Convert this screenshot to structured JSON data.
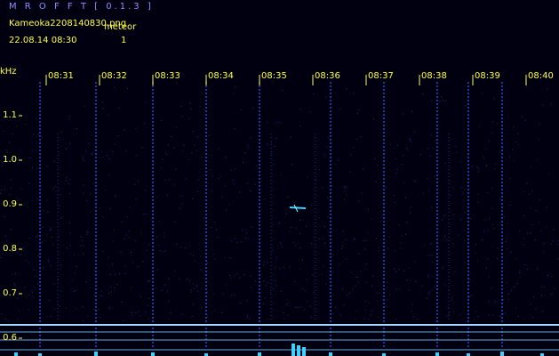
{
  "header": {
    "app_title": "M R O F F T [ 0.1.3 ]",
    "file_name": "Kameoka2208140830.png",
    "timestamp": "22.08.14 08:30",
    "meteor_label": "meteor",
    "meteor_count": "1"
  },
  "y_axis": {
    "unit": "kHz",
    "ticks": [
      "1.1",
      "1.0",
      "0.9",
      "0.8",
      "0.7",
      "0.6"
    ]
  },
  "x_axis": {
    "ticks": [
      "08:31",
      "08:32",
      "08:33",
      "08:34",
      "08:35",
      "08:36",
      "08:37",
      "08:38",
      "08:39",
      "08:40"
    ]
  },
  "colors": {
    "background": "#000010",
    "label_yellow": "#ffff40",
    "title_blue": "#8f8fff",
    "signal_cyan": "#40d0ff",
    "band_line": "#a0d8ff"
  }
}
